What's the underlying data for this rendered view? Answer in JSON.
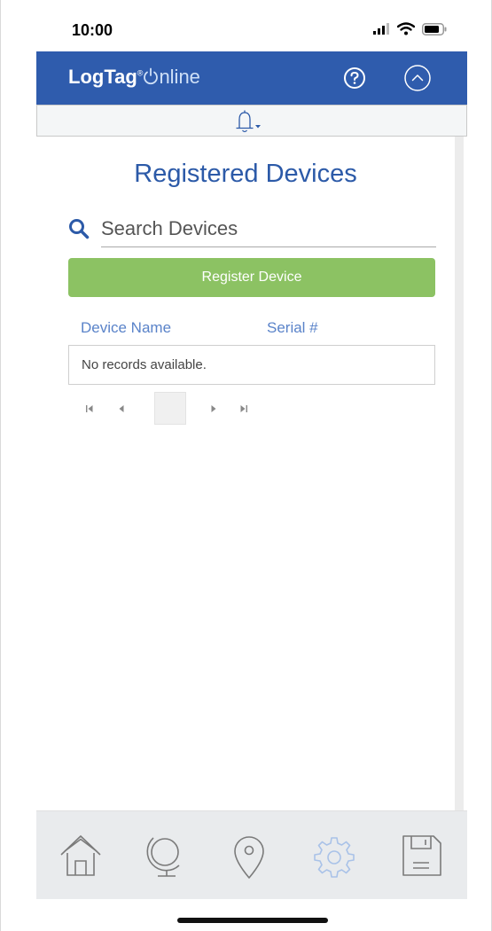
{
  "status_bar": {
    "time": "10:00",
    "icons": [
      "signal-icon",
      "wifi-icon",
      "battery-icon"
    ]
  },
  "header": {
    "logo_bold": "LogTag",
    "logo_reg": "®",
    "logo_light": "nline",
    "icons": [
      "help-icon",
      "collapse-up-icon"
    ],
    "color": "#2f5cad"
  },
  "notifications": {
    "icons": [
      "bell-icon",
      "caret-down-icon"
    ]
  },
  "main": {
    "title": "Registered Devices",
    "search": {
      "placeholder": "Search Devices",
      "value": ""
    },
    "register_label": "Register Device",
    "register_color": "#8cc263",
    "columns": [
      "Device Name",
      "Serial #"
    ],
    "empty_text": "No records available.",
    "pager_icons": [
      "first-page-icon",
      "prev-page-icon",
      "next-page-icon",
      "last-page-icon"
    ]
  },
  "bottom_nav": {
    "items": [
      "home-icon",
      "globe-icon",
      "location-pin-icon",
      "settings-icon",
      "save-icon"
    ],
    "active": "settings-icon",
    "active_color": "#a9c2e8"
  }
}
